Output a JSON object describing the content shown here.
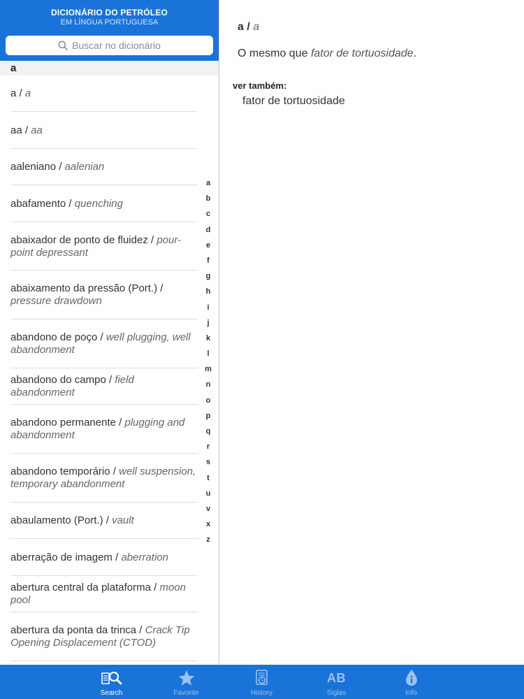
{
  "header": {
    "title": "DICIONÁRIO DO PETRÓLEO",
    "subtitle": "EM LÍNGUA PORTUGUESA"
  },
  "search": {
    "placeholder": "Buscar no dicionário"
  },
  "section_letter": "a",
  "entries": [
    {
      "pt": "a",
      "en": "a"
    },
    {
      "pt": "aa",
      "en": "aa"
    },
    {
      "pt": "aaleniano",
      "en": "aalenian"
    },
    {
      "pt": "abafamento",
      "en": "quenching"
    },
    {
      "pt": "abaixador de ponto de fluidez",
      "en": "pour-point depressant"
    },
    {
      "pt": "abaixamento da pressão (Port.)",
      "en": "pressure drawdown"
    },
    {
      "pt": "abandono de poço",
      "en": "well plugging, well abandonment"
    },
    {
      "pt": "abandono do campo",
      "en": "field abandonment"
    },
    {
      "pt": "abandono permanente",
      "en": "plugging and abandonment"
    },
    {
      "pt": "abandono temporário",
      "en": "well suspension, temporary abandonment"
    },
    {
      "pt": "abaulamento (Port.)",
      "en": "vault"
    },
    {
      "pt": "aberração de imagem",
      "en": "aberration"
    },
    {
      "pt": "abertura central da plataforma",
      "en": "moon pool"
    },
    {
      "pt": "abertura da ponta da trinca",
      "en": "Crack Tip Opening Displacement (CTOD)"
    }
  ],
  "index_letters": [
    "a",
    "b",
    "c",
    "d",
    "e",
    "f",
    "g",
    "h",
    "i",
    "j",
    "k",
    "l",
    "m",
    "n",
    "o",
    "p",
    "q",
    "r",
    "s",
    "t",
    "u",
    "v",
    "x",
    "z"
  ],
  "detail": {
    "term_pt": "a",
    "term_en": "a",
    "definition_prefix": "O mesmo que ",
    "definition_link": "fator de tortuosidade",
    "definition_suffix": ".",
    "see_also_label": "ver também:",
    "see_also_items": [
      "fator de tortuosidade"
    ]
  },
  "tabs": [
    {
      "label": "Search",
      "icon": "search-book-icon",
      "active": true
    },
    {
      "label": "Favorite",
      "icon": "star-icon",
      "active": false
    },
    {
      "label": "History",
      "icon": "history-icon",
      "active": false
    },
    {
      "label": "Siglas",
      "icon": "ab-icon",
      "icon_text": "AB",
      "active": false
    },
    {
      "label": "Info",
      "icon": "info-drop-icon",
      "active": false
    }
  ],
  "colors": {
    "brand_blue": "#1a73d9",
    "tab_inactive": "#9ec2ef",
    "tab_active": "#ffffff"
  }
}
